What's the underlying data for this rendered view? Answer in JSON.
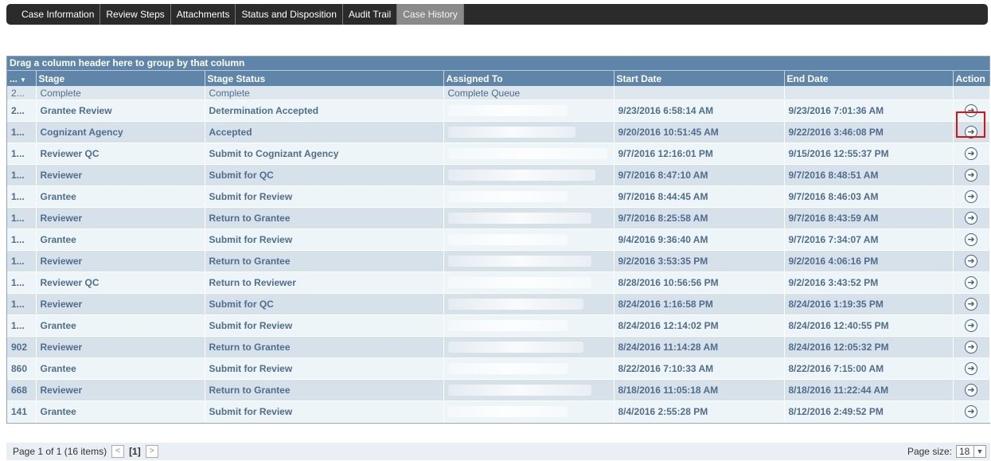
{
  "tabs": [
    {
      "label": "Case Information"
    },
    {
      "label": "Review Steps"
    },
    {
      "label": "Attachments"
    },
    {
      "label": "Status and Disposition"
    },
    {
      "label": "Audit Trail"
    },
    {
      "label": "Case History",
      "active": true
    }
  ],
  "grid": {
    "group_hint": "Drag a column header here to group by that column",
    "columns": {
      "id": "...",
      "stage": "Stage",
      "stage_status": "Stage Status",
      "assigned_to": "Assigned To",
      "start_date": "Start Date",
      "end_date": "End Date",
      "action": "Action"
    },
    "rows": [
      {
        "id": "2...",
        "stage": "Complete",
        "status": "Complete",
        "assigned": "Complete Queue",
        "start": "",
        "end": ""
      },
      {
        "id": "2...",
        "stage": "Grantee Review",
        "status": "Determination Accepted",
        "assigned": "",
        "start": "9/23/2016 6:58:14 AM",
        "end": "9/23/2016 7:01:36 AM"
      },
      {
        "id": "1...",
        "stage": "Cognizant Agency",
        "status": "Accepted",
        "assigned": "",
        "start": "9/20/2016 10:51:45 AM",
        "end": "9/22/2016 3:46:08 PM"
      },
      {
        "id": "1...",
        "stage": "Reviewer QC",
        "status": "Submit to Cognizant Agency",
        "assigned": "",
        "start": "9/7/2016 12:16:01 PM",
        "end": "9/15/2016 12:55:37 PM"
      },
      {
        "id": "1...",
        "stage": "Reviewer",
        "status": "Submit for QC",
        "assigned": "",
        "start": "9/7/2016 8:47:10 AM",
        "end": "9/7/2016 8:48:51 AM"
      },
      {
        "id": "1...",
        "stage": "Grantee",
        "status": "Submit for Review",
        "assigned": "",
        "start": "9/7/2016 8:44:45 AM",
        "end": "9/7/2016 8:46:03 AM"
      },
      {
        "id": "1...",
        "stage": "Reviewer",
        "status": "Return to Grantee",
        "assigned": "",
        "start": "9/7/2016 8:25:58 AM",
        "end": "9/7/2016 8:43:59 AM"
      },
      {
        "id": "1...",
        "stage": "Grantee",
        "status": "Submit for Review",
        "assigned": "",
        "start": "9/4/2016 9:36:40 AM",
        "end": "9/7/2016 7:34:07 AM"
      },
      {
        "id": "1...",
        "stage": "Reviewer",
        "status": "Return to Grantee",
        "assigned": "",
        "start": "9/2/2016 3:53:35 PM",
        "end": "9/2/2016 4:06:16 PM"
      },
      {
        "id": "1...",
        "stage": "Reviewer QC",
        "status": "Return to Reviewer",
        "assigned": "",
        "start": "8/28/2016 10:56:56 PM",
        "end": "9/2/2016 3:43:52 PM"
      },
      {
        "id": "1...",
        "stage": "Reviewer",
        "status": "Submit for QC",
        "assigned": "",
        "start": "8/24/2016 1:16:58 PM",
        "end": "8/24/2016 1:19:35 PM"
      },
      {
        "id": "1...",
        "stage": "Grantee",
        "status": "Submit for Review",
        "assigned": "",
        "start": "8/24/2016 12:14:02 PM",
        "end": "8/24/2016 12:40:55 PM"
      },
      {
        "id": "902",
        "stage": "Reviewer",
        "status": "Return to Grantee",
        "assigned": "",
        "start": "8/24/2016 11:14:28 AM",
        "end": "8/24/2016 12:05:32 PM"
      },
      {
        "id": "860",
        "stage": "Grantee",
        "status": "Submit for Review",
        "assigned": "",
        "start": "8/22/2016 7:10:33 AM",
        "end": "8/22/2016 7:15:00 AM"
      },
      {
        "id": "668",
        "stage": "Reviewer",
        "status": "Return to Grantee",
        "assigned": "",
        "start": "8/18/2016 11:05:18 AM",
        "end": "8/18/2016 11:22:44 AM"
      },
      {
        "id": "141",
        "stage": "Grantee",
        "status": "Submit for Review",
        "assigned": "",
        "start": "8/4/2016 2:55:28 PM",
        "end": "8/12/2016 2:49:52 PM"
      }
    ],
    "action_icon": "arrow-right-circle-icon"
  },
  "pager": {
    "summary": "Page 1 of 1 (16 items)",
    "current_page": "[1]",
    "prev_glyph": "<",
    "next_glyph": ">",
    "page_size_label": "Page size:",
    "page_size_value": "18"
  }
}
